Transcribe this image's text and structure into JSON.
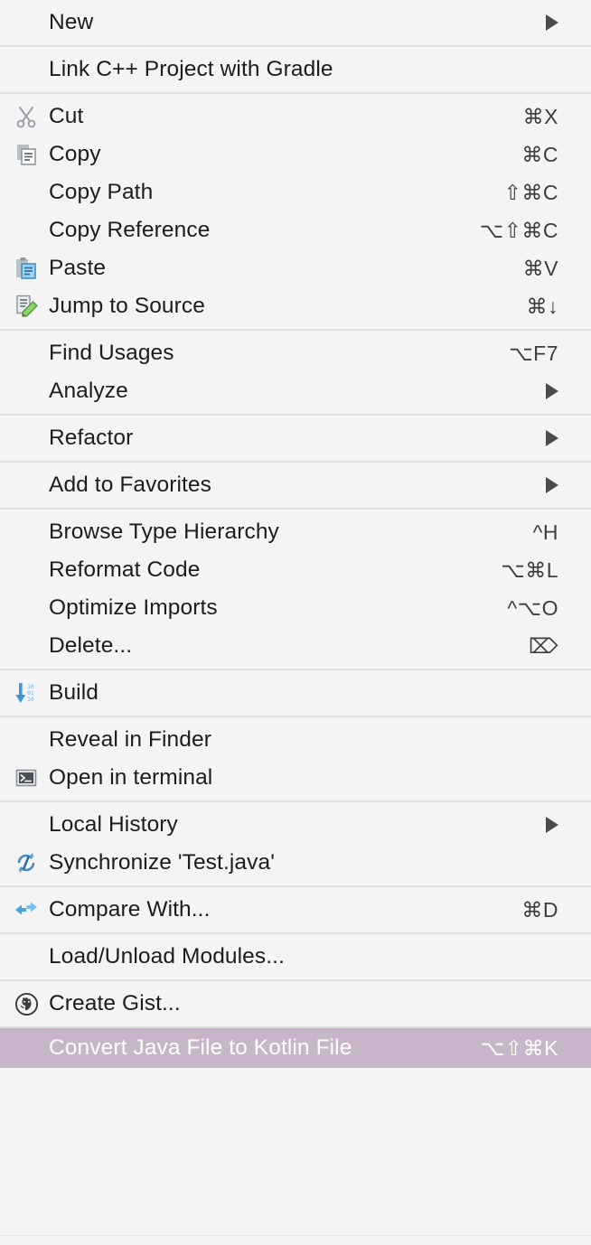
{
  "menu": {
    "type": "context-menu",
    "app": "IntelliJ IDEA / Android Studio project context menu",
    "colors": {
      "background": "#f4f4f4",
      "separator": "#dedede",
      "text": "#1c1c1c",
      "shortcut_text": "#3d3d3d",
      "selection_background": "#c7b5ca",
      "selection_text": "#ffffff"
    },
    "groups": [
      {
        "id": "group-new",
        "items": [
          {
            "label": "New",
            "shortcut": "",
            "icon": "",
            "submenu": true,
            "selected": false
          }
        ]
      },
      {
        "id": "group-link-gradle",
        "items": [
          {
            "label": "Link C++ Project with Gradle",
            "shortcut": "",
            "icon": "",
            "submenu": false,
            "selected": false
          }
        ]
      },
      {
        "id": "group-clipboard",
        "items": [
          {
            "label": "Cut",
            "shortcut": "⌘X",
            "icon": "scissors-icon",
            "submenu": false,
            "selected": false
          },
          {
            "label": "Copy",
            "shortcut": "⌘C",
            "icon": "copy-icon",
            "submenu": false,
            "selected": false
          },
          {
            "label": "Copy Path",
            "shortcut": "⇧⌘C",
            "icon": "",
            "submenu": false,
            "selected": false
          },
          {
            "label": "Copy Reference",
            "shortcut": "⌥⇧⌘C",
            "icon": "",
            "submenu": false,
            "selected": false
          },
          {
            "label": "Paste",
            "shortcut": "⌘V",
            "icon": "paste-icon",
            "submenu": false,
            "selected": false
          },
          {
            "label": "Jump to Source",
            "shortcut": "⌘↓",
            "icon": "jump-to-source-icon",
            "submenu": false,
            "selected": false
          }
        ]
      },
      {
        "id": "group-find",
        "items": [
          {
            "label": "Find Usages",
            "shortcut": "⌥F7",
            "icon": "",
            "submenu": false,
            "selected": false
          },
          {
            "label": "Analyze",
            "shortcut": "",
            "icon": "",
            "submenu": true,
            "selected": false
          }
        ]
      },
      {
        "id": "group-refactor",
        "items": [
          {
            "label": "Refactor",
            "shortcut": "",
            "icon": "",
            "submenu": true,
            "selected": false
          }
        ]
      },
      {
        "id": "group-favorites",
        "items": [
          {
            "label": "Add to Favorites",
            "shortcut": "",
            "icon": "",
            "submenu": true,
            "selected": false
          }
        ]
      },
      {
        "id": "group-code",
        "items": [
          {
            "label": "Browse Type Hierarchy",
            "shortcut": "^H",
            "icon": "",
            "submenu": false,
            "selected": false
          },
          {
            "label": "Reformat Code",
            "shortcut": "⌥⌘L",
            "icon": "",
            "submenu": false,
            "selected": false
          },
          {
            "label": "Optimize Imports",
            "shortcut": "^⌥O",
            "icon": "",
            "submenu": false,
            "selected": false
          },
          {
            "label": "Delete...",
            "shortcut": "⌦",
            "icon": "",
            "submenu": false,
            "selected": false
          }
        ]
      },
      {
        "id": "group-build",
        "items": [
          {
            "label": "Build",
            "shortcut": "",
            "icon": "build-icon",
            "submenu": false,
            "selected": false
          }
        ]
      },
      {
        "id": "group-reveal",
        "items": [
          {
            "label": "Reveal in Finder",
            "shortcut": "",
            "icon": "",
            "submenu": false,
            "selected": false
          },
          {
            "label": "Open in terminal",
            "shortcut": "",
            "icon": "terminal-icon",
            "submenu": false,
            "selected": false
          }
        ]
      },
      {
        "id": "group-history",
        "items": [
          {
            "label": "Local History",
            "shortcut": "",
            "icon": "",
            "submenu": true,
            "selected": false
          },
          {
            "label": "Synchronize 'Test.java'",
            "shortcut": "",
            "icon": "synchronize-icon",
            "submenu": false,
            "selected": false
          }
        ]
      },
      {
        "id": "group-compare",
        "items": [
          {
            "label": "Compare With...",
            "shortcut": "⌘D",
            "icon": "compare-icon",
            "submenu": false,
            "selected": false
          }
        ]
      },
      {
        "id": "group-modules",
        "items": [
          {
            "label": "Load/Unload Modules...",
            "shortcut": "",
            "icon": "",
            "submenu": false,
            "selected": false
          }
        ]
      },
      {
        "id": "group-gist",
        "items": [
          {
            "label": "Create Gist...",
            "shortcut": "",
            "icon": "github-icon",
            "submenu": false,
            "selected": false
          }
        ]
      },
      {
        "id": "group-kotlin",
        "items": [
          {
            "label": "Convert Java File to Kotlin File",
            "shortcut": "⌥⇧⌘K",
            "icon": "",
            "submenu": false,
            "selected": true
          }
        ]
      }
    ]
  }
}
